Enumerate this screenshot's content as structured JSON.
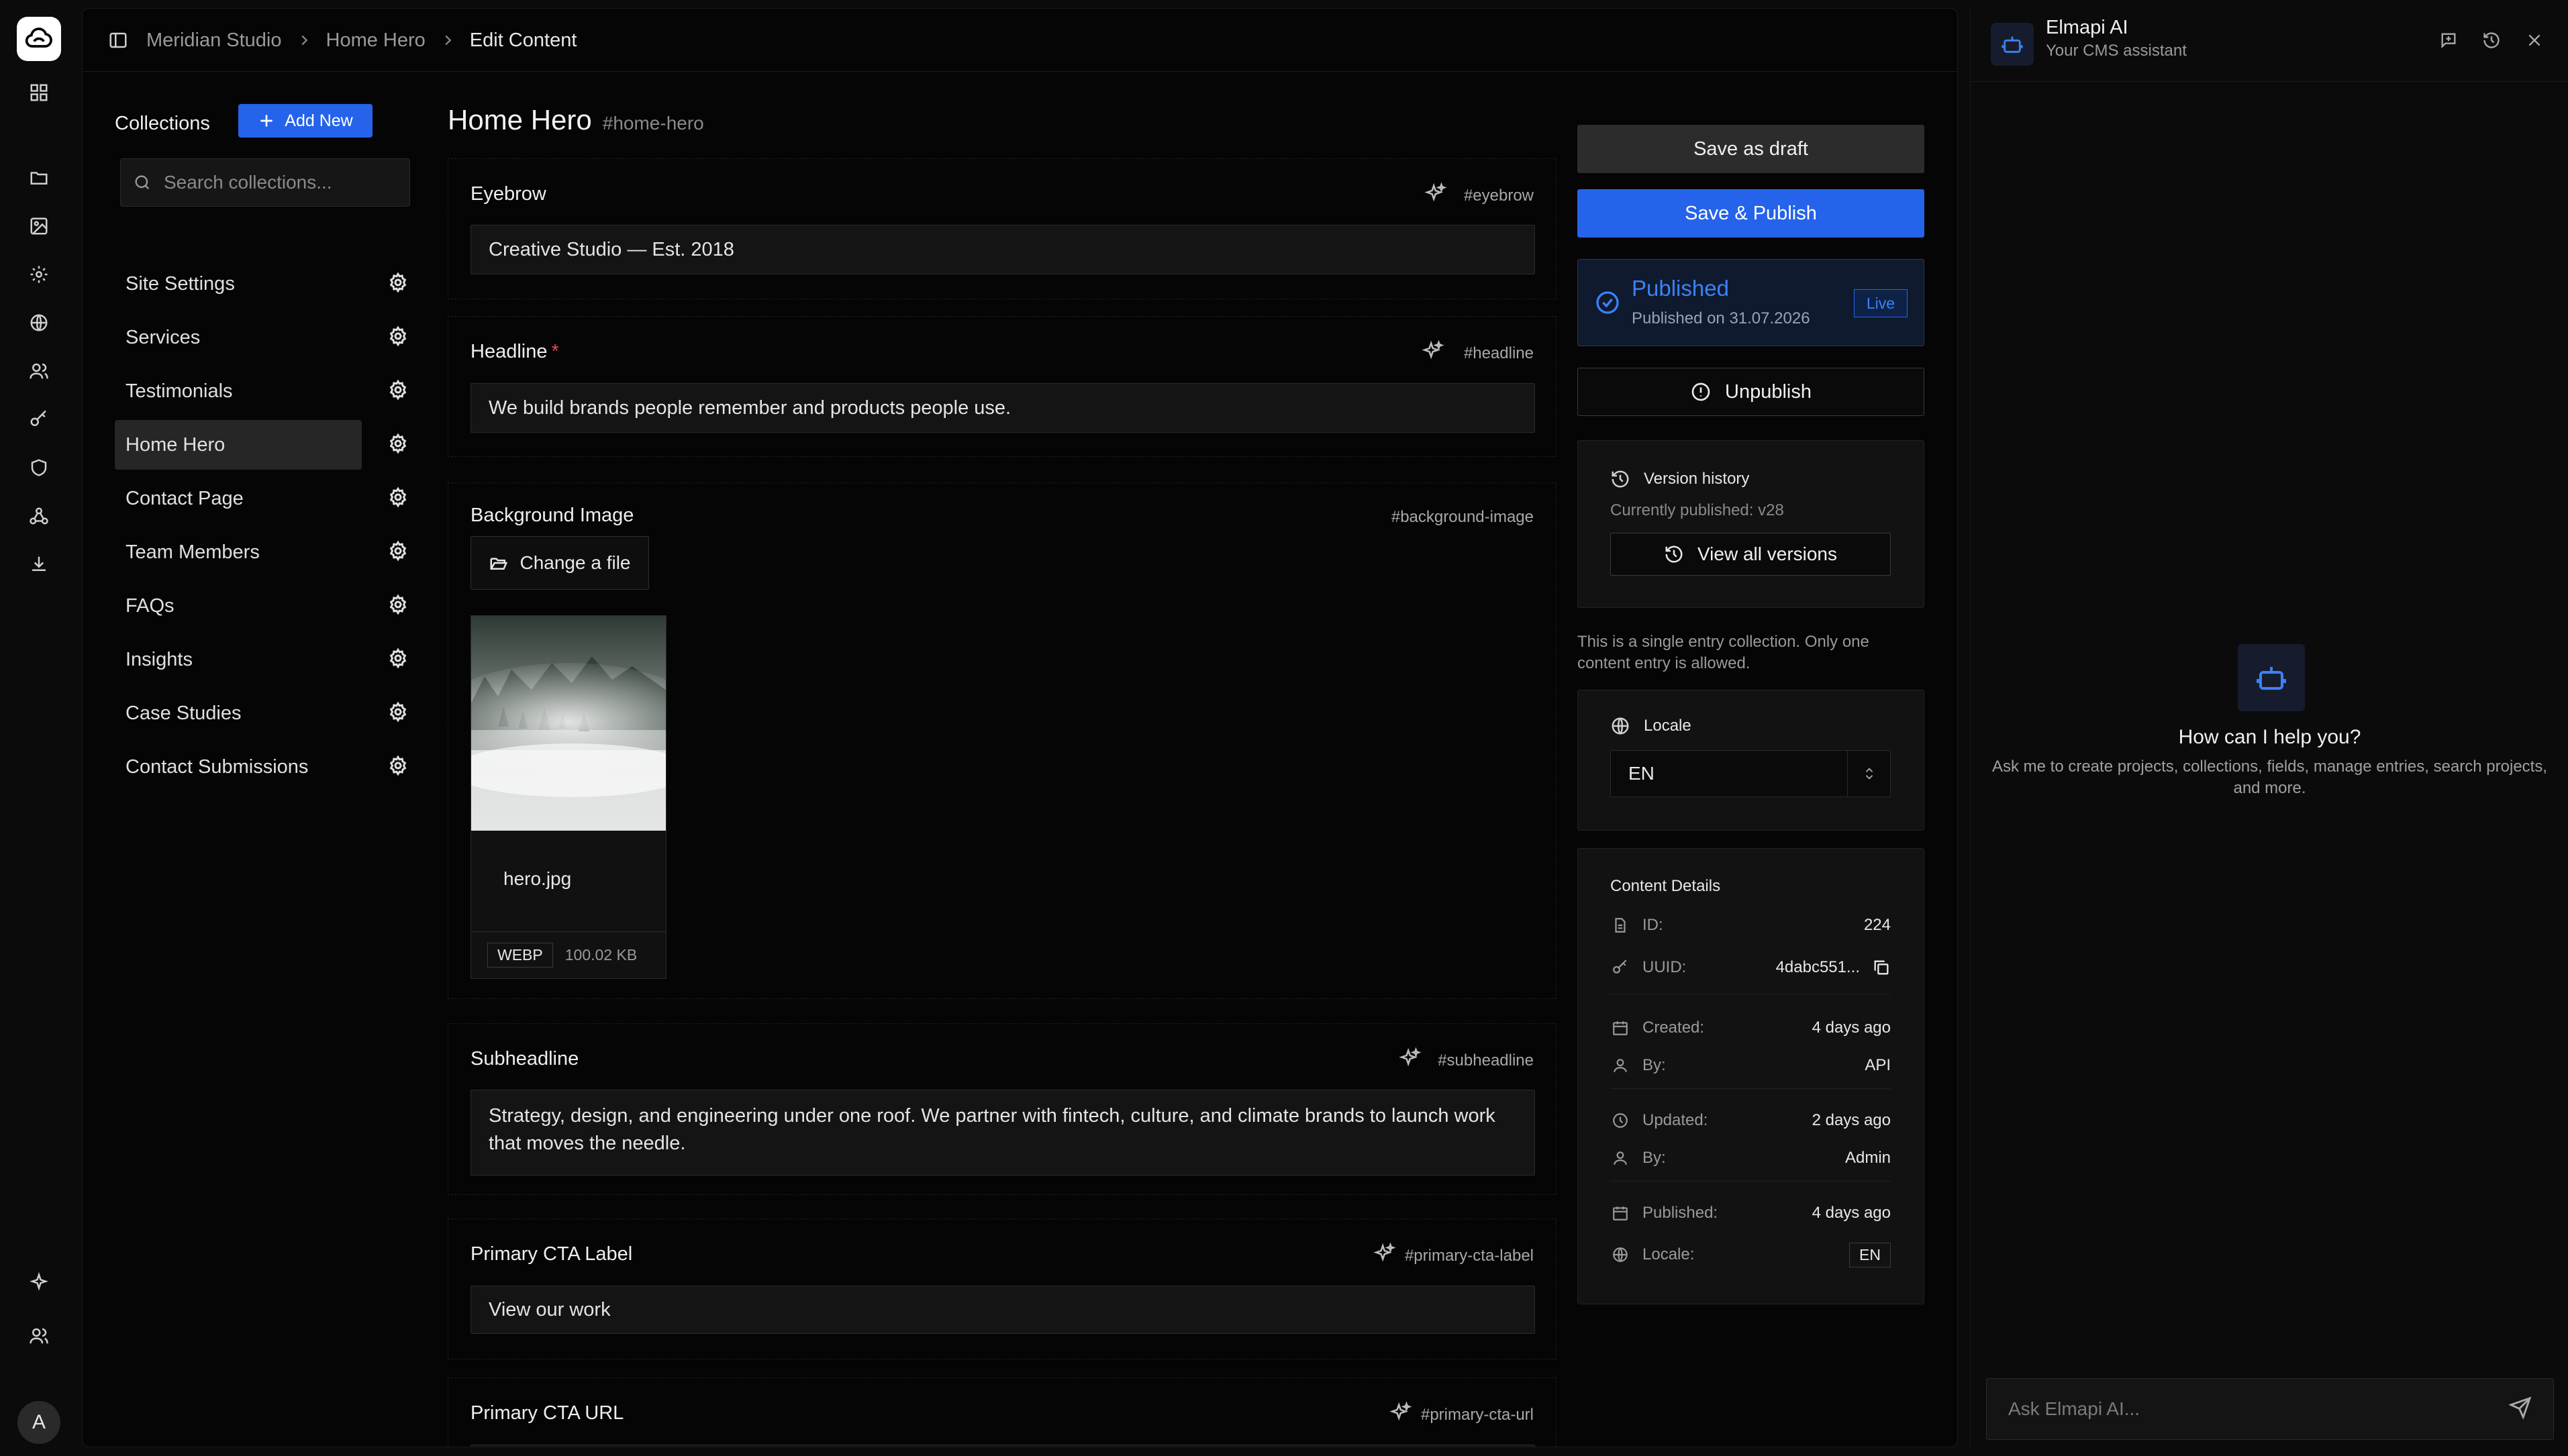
{
  "breadcrumb": [
    "Meridian Studio",
    "Home Hero",
    "Edit Content"
  ],
  "collections": {
    "title": "Collections",
    "add_new_label": "Add New",
    "search_placeholder": "Search collections...",
    "items": [
      "Site Settings",
      "Services",
      "Testimonials",
      "Home Hero",
      "Contact Page",
      "Team Members",
      "FAQs",
      "Insights",
      "Case Studies",
      "Contact Submissions"
    ],
    "active_item": "Home Hero"
  },
  "editor": {
    "title": "Home Hero",
    "slug": "#home-hero",
    "fields": {
      "eyebrow": {
        "label": "Eyebrow",
        "key": "#eyebrow",
        "value": "Creative Studio — Est. 2018"
      },
      "headline": {
        "label": "Headline",
        "required_mark": "*",
        "key": "#headline",
        "value": "We build brands people remember and products people use."
      },
      "background_image": {
        "label": "Background Image",
        "key": "#background-image",
        "change_label": "Change a file",
        "file_name": "hero.jpg",
        "file_type": "WEBP",
        "file_size": "100.02 KB"
      },
      "subheadline": {
        "label": "Subheadline",
        "key": "#subheadline",
        "value": "Strategy, design, and engineering under one roof. We partner with fintech, culture, and climate brands to launch work that moves the needle."
      },
      "primary_cta_label": {
        "label": "Primary CTA Label",
        "key": "#primary-cta-label",
        "value": "View our work"
      },
      "primary_cta_url": {
        "label": "Primary CTA URL",
        "key": "#primary-cta-url"
      }
    }
  },
  "sidebar_right": {
    "save_draft_label": "Save as draft",
    "save_publish_label": "Save & Publish",
    "status": {
      "title": "Published",
      "subtitle": "Published on 31.07.2026",
      "badge": "Live"
    },
    "unpublish_label": "Unpublish",
    "version": {
      "title": "Version history",
      "current": "Currently published: v28",
      "view_all_label": "View all versions"
    },
    "single_entry_note": "This is a single entry collection. Only one content entry is allowed.",
    "locale": {
      "title": "Locale",
      "value": "EN"
    },
    "details": {
      "title": "Content Details",
      "id_label": "ID:",
      "id_value": "224",
      "uuid_label": "UUID:",
      "uuid_value": "4dabc551...",
      "created_label": "Created:",
      "created_value": "4 days ago",
      "created_by_label": "By:",
      "created_by_value": "API",
      "updated_label": "Updated:",
      "updated_value": "2 days ago",
      "updated_by_label": "By:",
      "updated_by_value": "Admin",
      "published_label": "Published:",
      "published_value": "4 days ago",
      "locale_label": "Locale:",
      "locale_value": "EN"
    }
  },
  "ai_panel": {
    "name": "Elmapi AI",
    "subtitle": "Your CMS assistant",
    "help_title": "How can I help you?",
    "help_text": "Ask me to create projects, collections, fields, manage entries, search projects, and more.",
    "input_placeholder": "Ask Elmapi AI..."
  },
  "user": {
    "avatar_initial": "A"
  },
  "colors": {
    "accent": "#2563eb",
    "background": "#050505",
    "required": "#e5484d"
  }
}
